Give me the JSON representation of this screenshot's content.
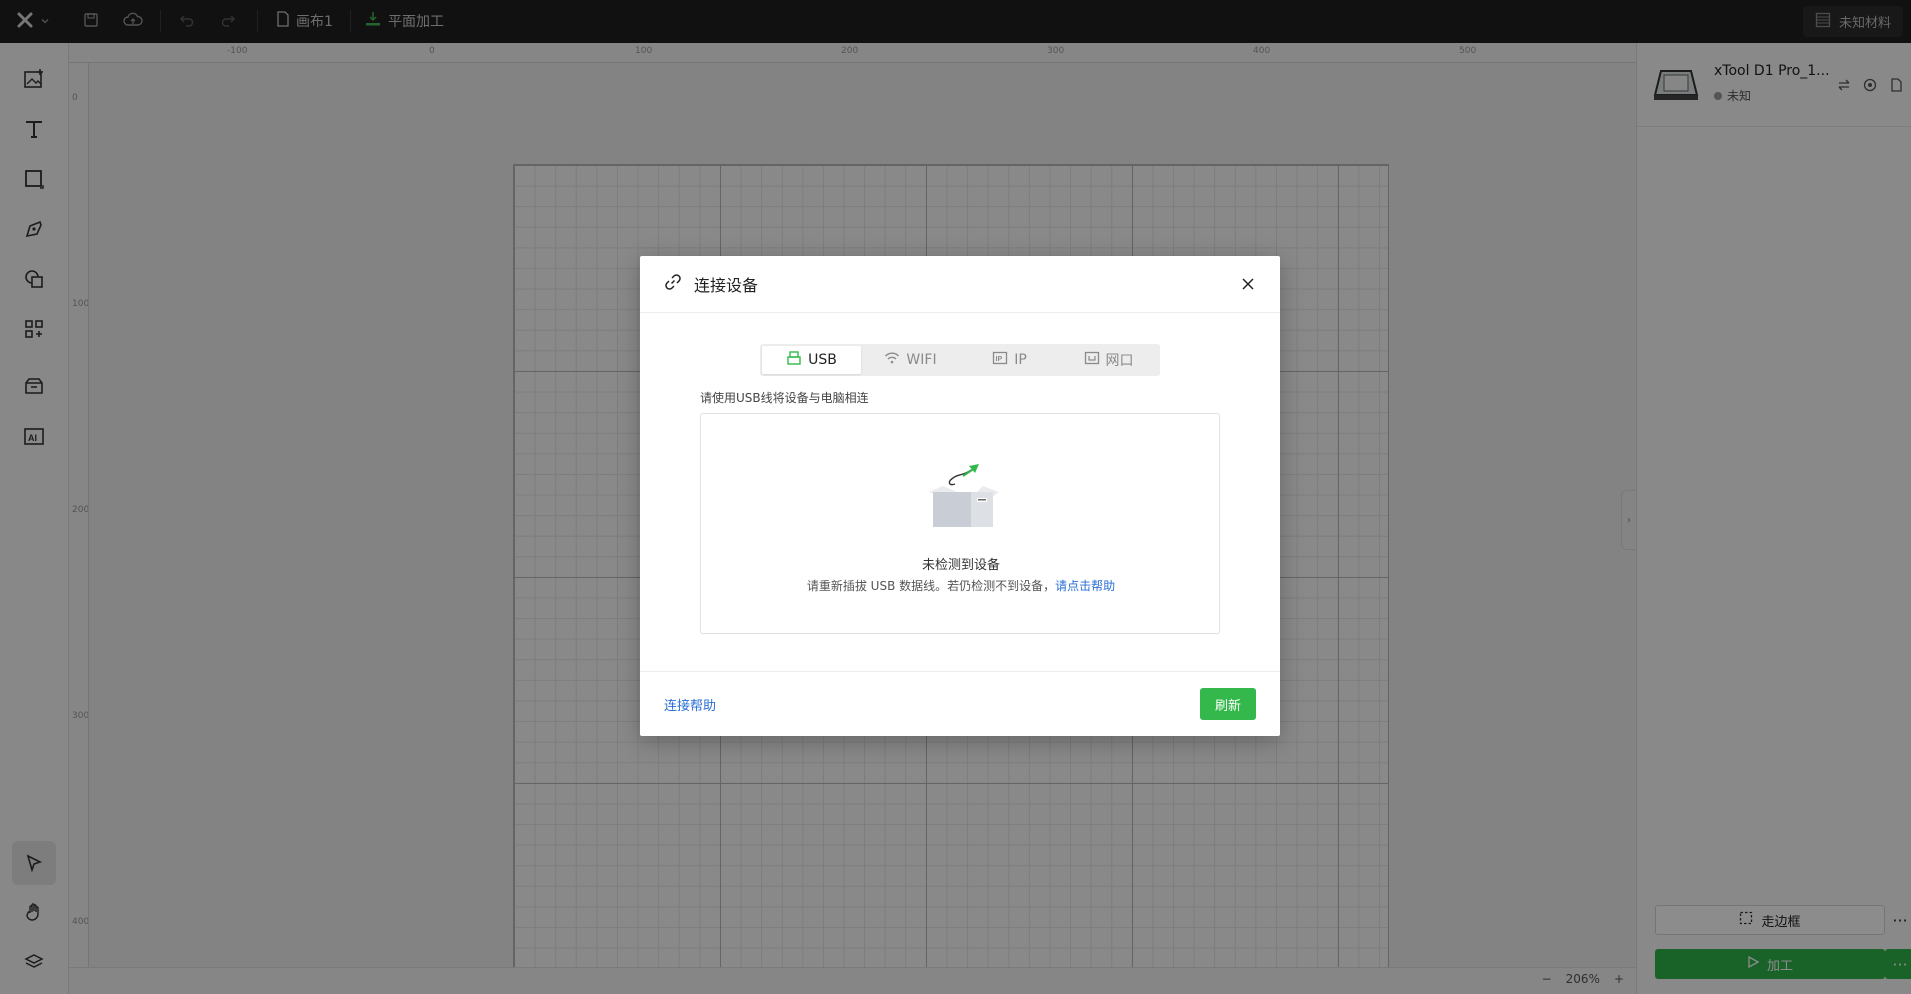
{
  "topbar": {
    "logo_icon": "xtool-logo-icon",
    "canvas_name": "画布1",
    "mode": "平面加工",
    "material": "未知材料"
  },
  "left_toolbar": {
    "icons": [
      "image-add-icon",
      "text-icon",
      "rectangle-icon",
      "pen-icon",
      "shapes-icon",
      "apps-icon",
      "material-box-icon",
      "ai-image-icon",
      "select-arrow-icon",
      "hand-icon",
      "layers-icon"
    ]
  },
  "rulers": {
    "h_labels": [
      "-100",
      "0",
      "100",
      "200",
      "300",
      "400",
      "500"
    ],
    "v_labels": [
      "0",
      "100",
      "200",
      "300",
      "400"
    ]
  },
  "status": {
    "zoom_minus": "−",
    "zoom": "206%",
    "zoom_plus": "+"
  },
  "device": {
    "name": "xTool D1 Pro_1...",
    "status": "未知"
  },
  "right_panel": {
    "frame_label": "走边框",
    "process_label": "加工",
    "more": "···"
  },
  "modal": {
    "title": "连接设备",
    "tabs": [
      "USB",
      "WIFI",
      "IP",
      "网口"
    ],
    "active_tab": "USB",
    "hint": "请使用USB线将设备与电脑相连",
    "empty_title": "未检测到设备",
    "empty_desc": "请重新插拔 USB 数据线。若仍检测不到设备，",
    "empty_link": "请点击帮助",
    "help_link": "连接帮助",
    "refresh_label": "刷新"
  },
  "colors": {
    "accent_green": "#34b84c",
    "link_blue": "#2a6fd6"
  }
}
